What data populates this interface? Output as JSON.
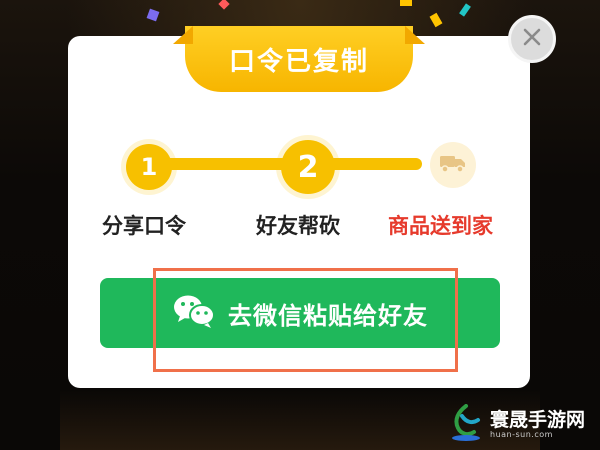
{
  "popup": {
    "banner_title": "口令已复制",
    "steps": [
      {
        "number": "1",
        "label": "分享口令"
      },
      {
        "number": "2",
        "label": "好友帮砍"
      },
      {
        "icon": "truck-icon",
        "label": "商品送到家"
      }
    ],
    "cta_label": "去微信粘贴给好友",
    "close_icon": "close-icon"
  },
  "colors": {
    "banner": "#f7b500",
    "progress": "#f7c000",
    "cta": "#1fb85b",
    "highlight": "#f0704a",
    "final_step_label": "#e63a2c"
  },
  "watermark": {
    "text": "寰晟手游网",
    "subtext": "huan-sun.com"
  }
}
